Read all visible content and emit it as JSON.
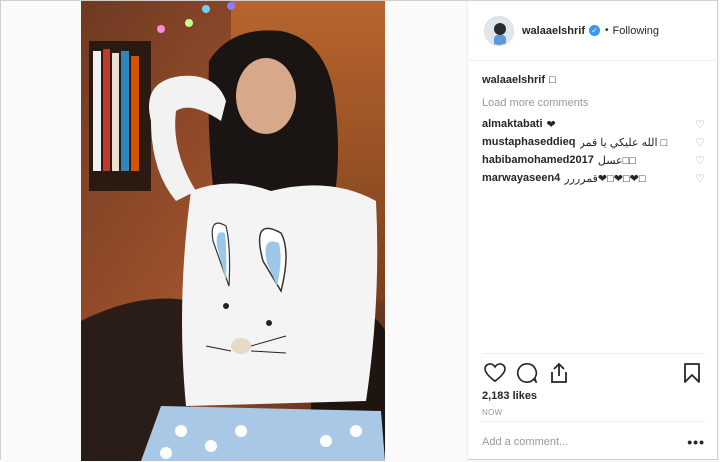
{
  "post": {
    "username": "walaaelshrif",
    "follow_status": "Following",
    "caption_author": "walaaelshrif",
    "caption_text": "□",
    "load_more": "Load more comments",
    "comments": [
      {
        "author": "almaktabati",
        "text": "❤"
      },
      {
        "author": "mustaphaseddieq",
        "text": "الله عليكي يا قمر □"
      },
      {
        "author": "habibamohamed2017",
        "text": "عسل□□"
      },
      {
        "author": "marwayaseen4",
        "text": "قمرررر❤□❤□❤□"
      }
    ],
    "likes": "2,183 likes",
    "timestamp": "NOW",
    "add_comment_placeholder": "Add a comment...",
    "options": "•••"
  },
  "icons": {
    "like": "heart-icon",
    "comment": "comment-icon",
    "share": "share-icon",
    "save": "bookmark-icon",
    "comment_like": "small-heart-icon",
    "verified": "verified-badge-icon"
  },
  "colors": {
    "verified": "#3897f0",
    "muted": "#999999",
    "text": "#262626"
  }
}
